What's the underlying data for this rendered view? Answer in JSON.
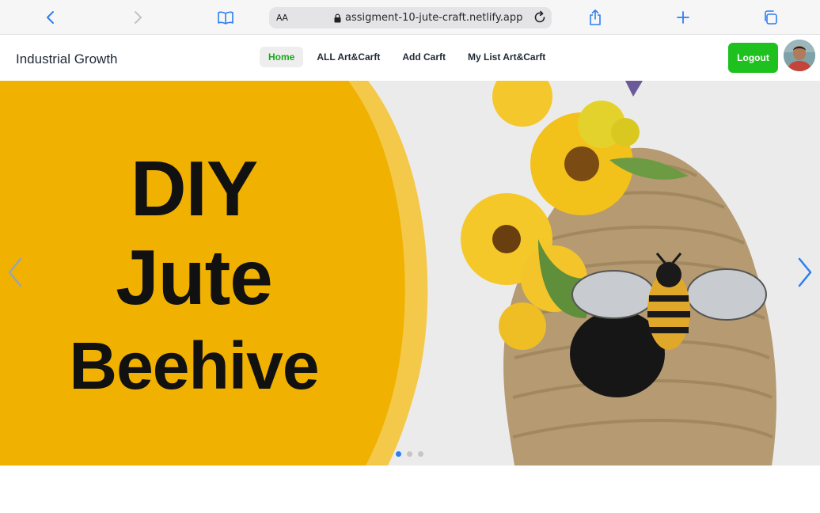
{
  "browser": {
    "text_size_label": "AA",
    "url": "assigment-10-jute-craft.netlify.app",
    "icons": [
      "back-icon",
      "forward-icon",
      "bookmarks-icon",
      "lock-icon",
      "reload-icon",
      "share-icon",
      "new-tab-icon",
      "tabs-icon"
    ]
  },
  "navbar": {
    "brand": "Industrial Growth",
    "links": [
      {
        "label": "Home",
        "active": true
      },
      {
        "label": "ALL Art&Carft",
        "active": false
      },
      {
        "label": "Add Carft",
        "active": false
      },
      {
        "label": "My List Art&Carft",
        "active": false
      }
    ],
    "logout_label": "Logout",
    "avatar_icon": "user-avatar"
  },
  "carousel": {
    "slide_title": {
      "line1": "DIY",
      "line2": "Jute",
      "line3": "Beehive"
    },
    "slide_count": 3,
    "active_slide": 1,
    "colors": {
      "banner": "#f0b100",
      "ring": "#f4c94a",
      "jute": "#b59a72",
      "arrow": "#2d7ff0"
    }
  },
  "colors": {
    "accent_green": "#1fc11f",
    "active_link_green": "#1ca81c",
    "text_dark": "#1f2937"
  }
}
